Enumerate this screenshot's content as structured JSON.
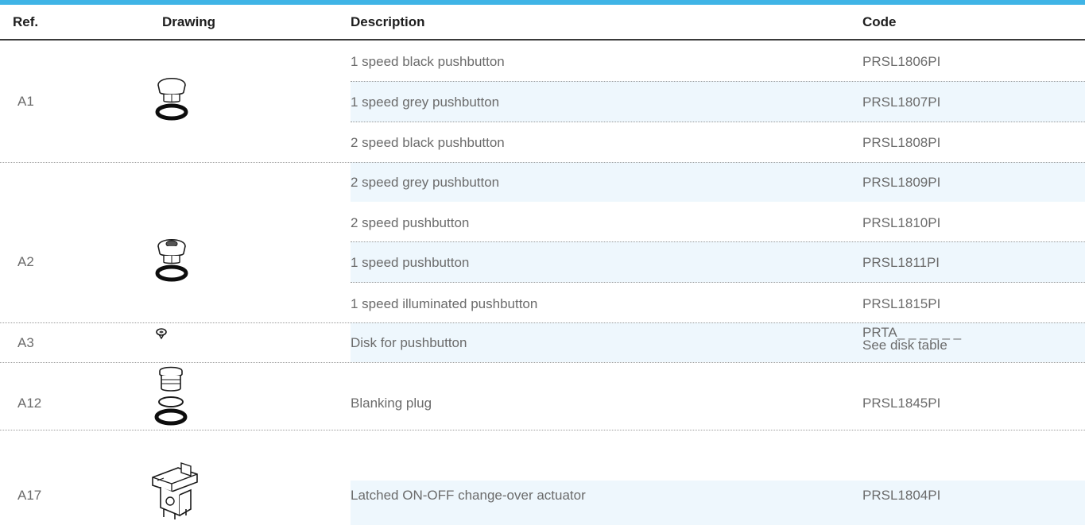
{
  "header": {
    "ref": "Ref.",
    "drawing": "Drawing",
    "description": "Description",
    "code": "Code"
  },
  "groups": [
    {
      "ref": "A1",
      "drawing": "pushbutton-icon",
      "rows": [
        {
          "description": "1 speed black pushbutton",
          "code": "PRSL1806PI"
        },
        {
          "description": "1 speed grey pushbutton",
          "code": "PRSL1807PI"
        },
        {
          "description": "2 speed black pushbutton",
          "code": "PRSL1808PI"
        },
        {
          "description": "2 speed grey pushbutton",
          "code": "PRSL1809PI"
        }
      ]
    },
    {
      "ref": "A2",
      "drawing": "pushbutton-open-icon",
      "rows": [
        {
          "description": "2 speed pushbutton",
          "code": "PRSL1810PI"
        },
        {
          "description": "1 speed pushbutton",
          "code": "PRSL1811PI"
        },
        {
          "description": "1 speed illuminated pushbutton",
          "code": "PRSL1815PI"
        }
      ]
    },
    {
      "ref": "A3",
      "drawing": "disk-icon",
      "rows": [
        {
          "description": "Disk for pushbutton",
          "code_line1": "PRTA_ _ _ _ _ _",
          "code_line2": "See disk table"
        }
      ]
    },
    {
      "ref": "A12",
      "drawing": "blanking-plug-icon",
      "rows": [
        {
          "description": "Blanking plug",
          "code": "PRSL1845PI"
        }
      ]
    },
    {
      "ref": "A17",
      "drawing": "actuator-icon",
      "rows": [
        {
          "description": "Latched ON-OFF change-over actuator",
          "code": "PRSL1804PI"
        }
      ]
    }
  ],
  "colors": {
    "accent_bar": "#3fb4e6",
    "row_band": "#eef7fd"
  }
}
